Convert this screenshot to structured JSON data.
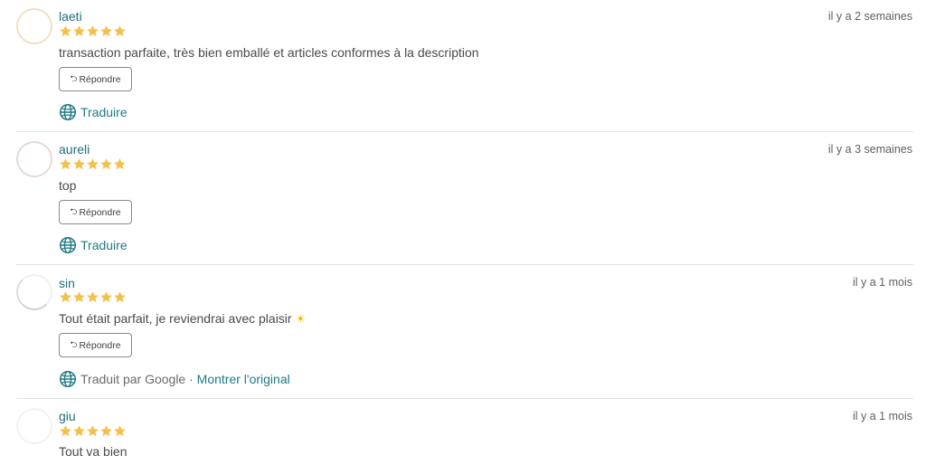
{
  "colors": {
    "accent": "#1f7a84",
    "star": "#f4c04c",
    "divider": "#e3e3e3"
  },
  "reply_label": "Répondre",
  "translate_label": "Traduire",
  "reviews": [
    {
      "username": "laeti",
      "rating": 5,
      "date": "il y a 2 semaines",
      "comment": "transaction parfaite, très bien emballé et articles conformes à la description",
      "translation": {
        "type": "link",
        "label": "Traduire"
      }
    },
    {
      "username": "aureli",
      "rating": 5,
      "date": "il y a 3 semaines",
      "comment": "top",
      "translation": {
        "type": "link",
        "label": "Traduire"
      }
    },
    {
      "username": "sin",
      "rating": 5,
      "date": "il y a 1 mois",
      "comment": "Tout était parfait, je reviendrai avec plaisir",
      "comment_emoji": "sun-emoji",
      "translation": {
        "type": "translated",
        "label": "Traduit par Google",
        "separator": " · ",
        "link": "Montrer l'original"
      }
    },
    {
      "username": "giu",
      "rating": 5,
      "date": "il y a 1 mois",
      "comment": "Tout va bien"
    }
  ]
}
